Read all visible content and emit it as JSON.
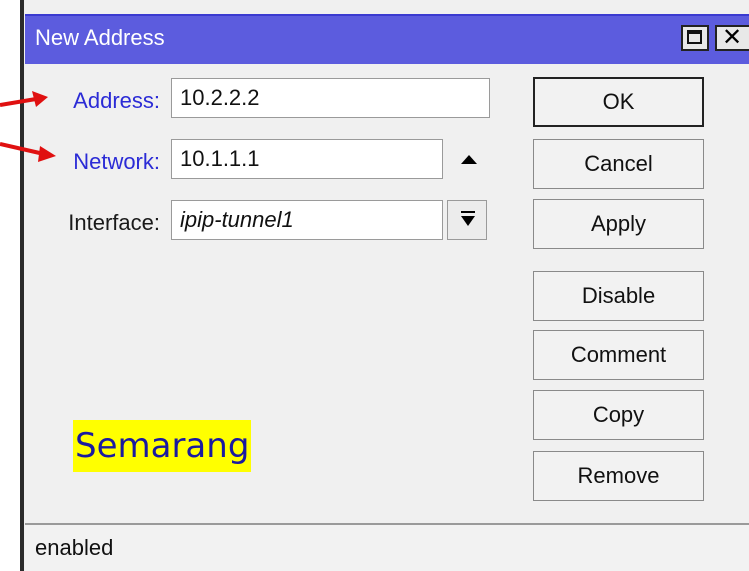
{
  "window": {
    "title": "New Address"
  },
  "form": {
    "address": {
      "label": "Address:",
      "value": "10.2.2.2"
    },
    "network": {
      "label": "Network:",
      "value": "10.1.1.1"
    },
    "interface": {
      "label": "Interface:",
      "value": "ipip-tunnel1"
    }
  },
  "buttons": {
    "ok": "OK",
    "cancel": "Cancel",
    "apply": "Apply",
    "disable": "Disable",
    "comment": "Comment",
    "copy": "Copy",
    "remove": "Remove"
  },
  "overlay": {
    "text": "Semarang"
  },
  "status": {
    "text": "enabled"
  },
  "colors": {
    "titlebar": "#5c5cde",
    "label_highlight": "#2b2bd6",
    "annotation_arrow": "#e01010",
    "highlight_bg": "#ffff00"
  }
}
